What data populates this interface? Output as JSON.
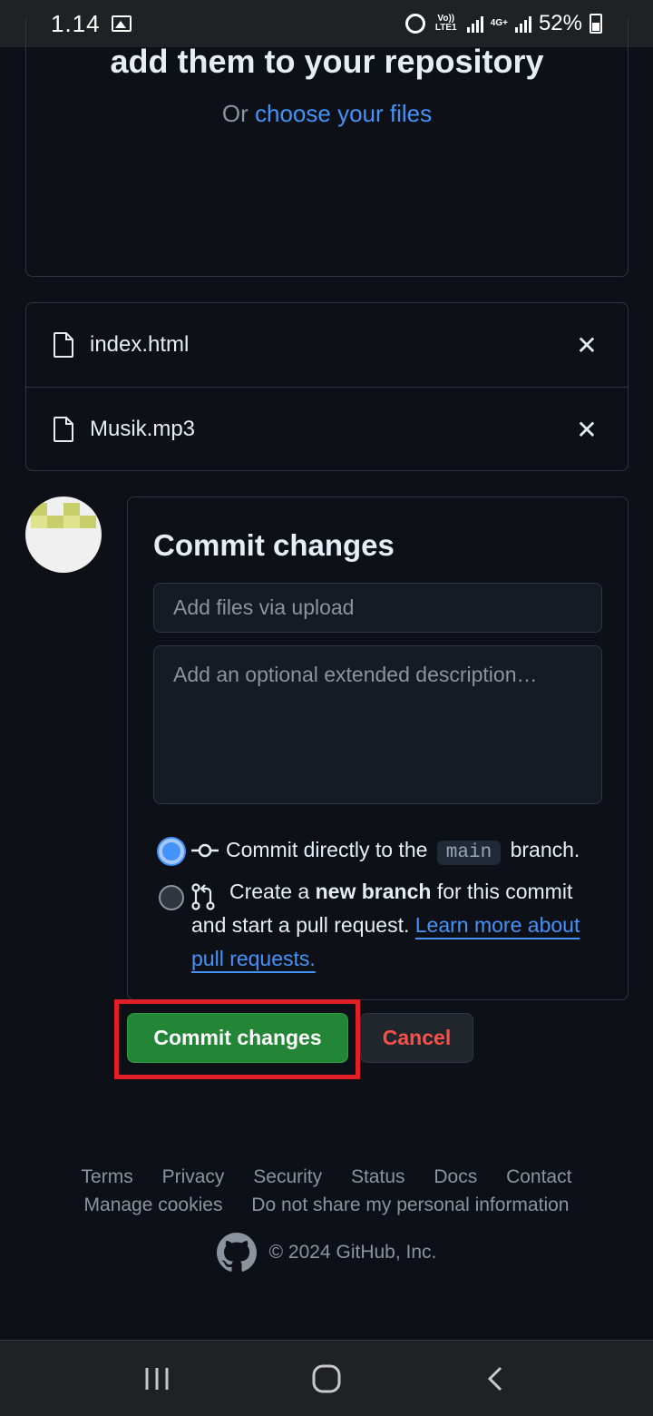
{
  "status_bar": {
    "time": "1.14",
    "network_1": "Vo)) LTE1",
    "network_2": "4G+",
    "battery": "52%"
  },
  "dropzone": {
    "title": "add them to your repository",
    "or_text": "Or",
    "choose_link": "choose your files"
  },
  "files": [
    {
      "name": "index.html"
    },
    {
      "name": "Musik.mp3"
    }
  ],
  "commit": {
    "title": "Commit changes",
    "summary_placeholder": "Add files via upload",
    "description_placeholder": "Add an optional extended description…",
    "option_direct": {
      "prefix": "Commit directly to the",
      "branch": "main",
      "suffix": "branch."
    },
    "option_new": {
      "prefix": "Create a",
      "bold": "new branch",
      "middle": "for this commit and start a pull request.",
      "link": "Learn more about pull requests."
    },
    "commit_button": "Commit changes",
    "cancel_button": "Cancel"
  },
  "footer": {
    "links_row1": [
      "Terms",
      "Privacy",
      "Security",
      "Status",
      "Docs",
      "Contact"
    ],
    "links_row2": [
      "Manage cookies",
      "Do not share my personal information"
    ],
    "copyright": "© 2024 GitHub, Inc."
  },
  "colors": {
    "background": "#0d1117",
    "accent_link": "#4493f8",
    "commit_green": "#238636",
    "cancel_red": "#f85149",
    "highlight_red": "#e01f26"
  }
}
